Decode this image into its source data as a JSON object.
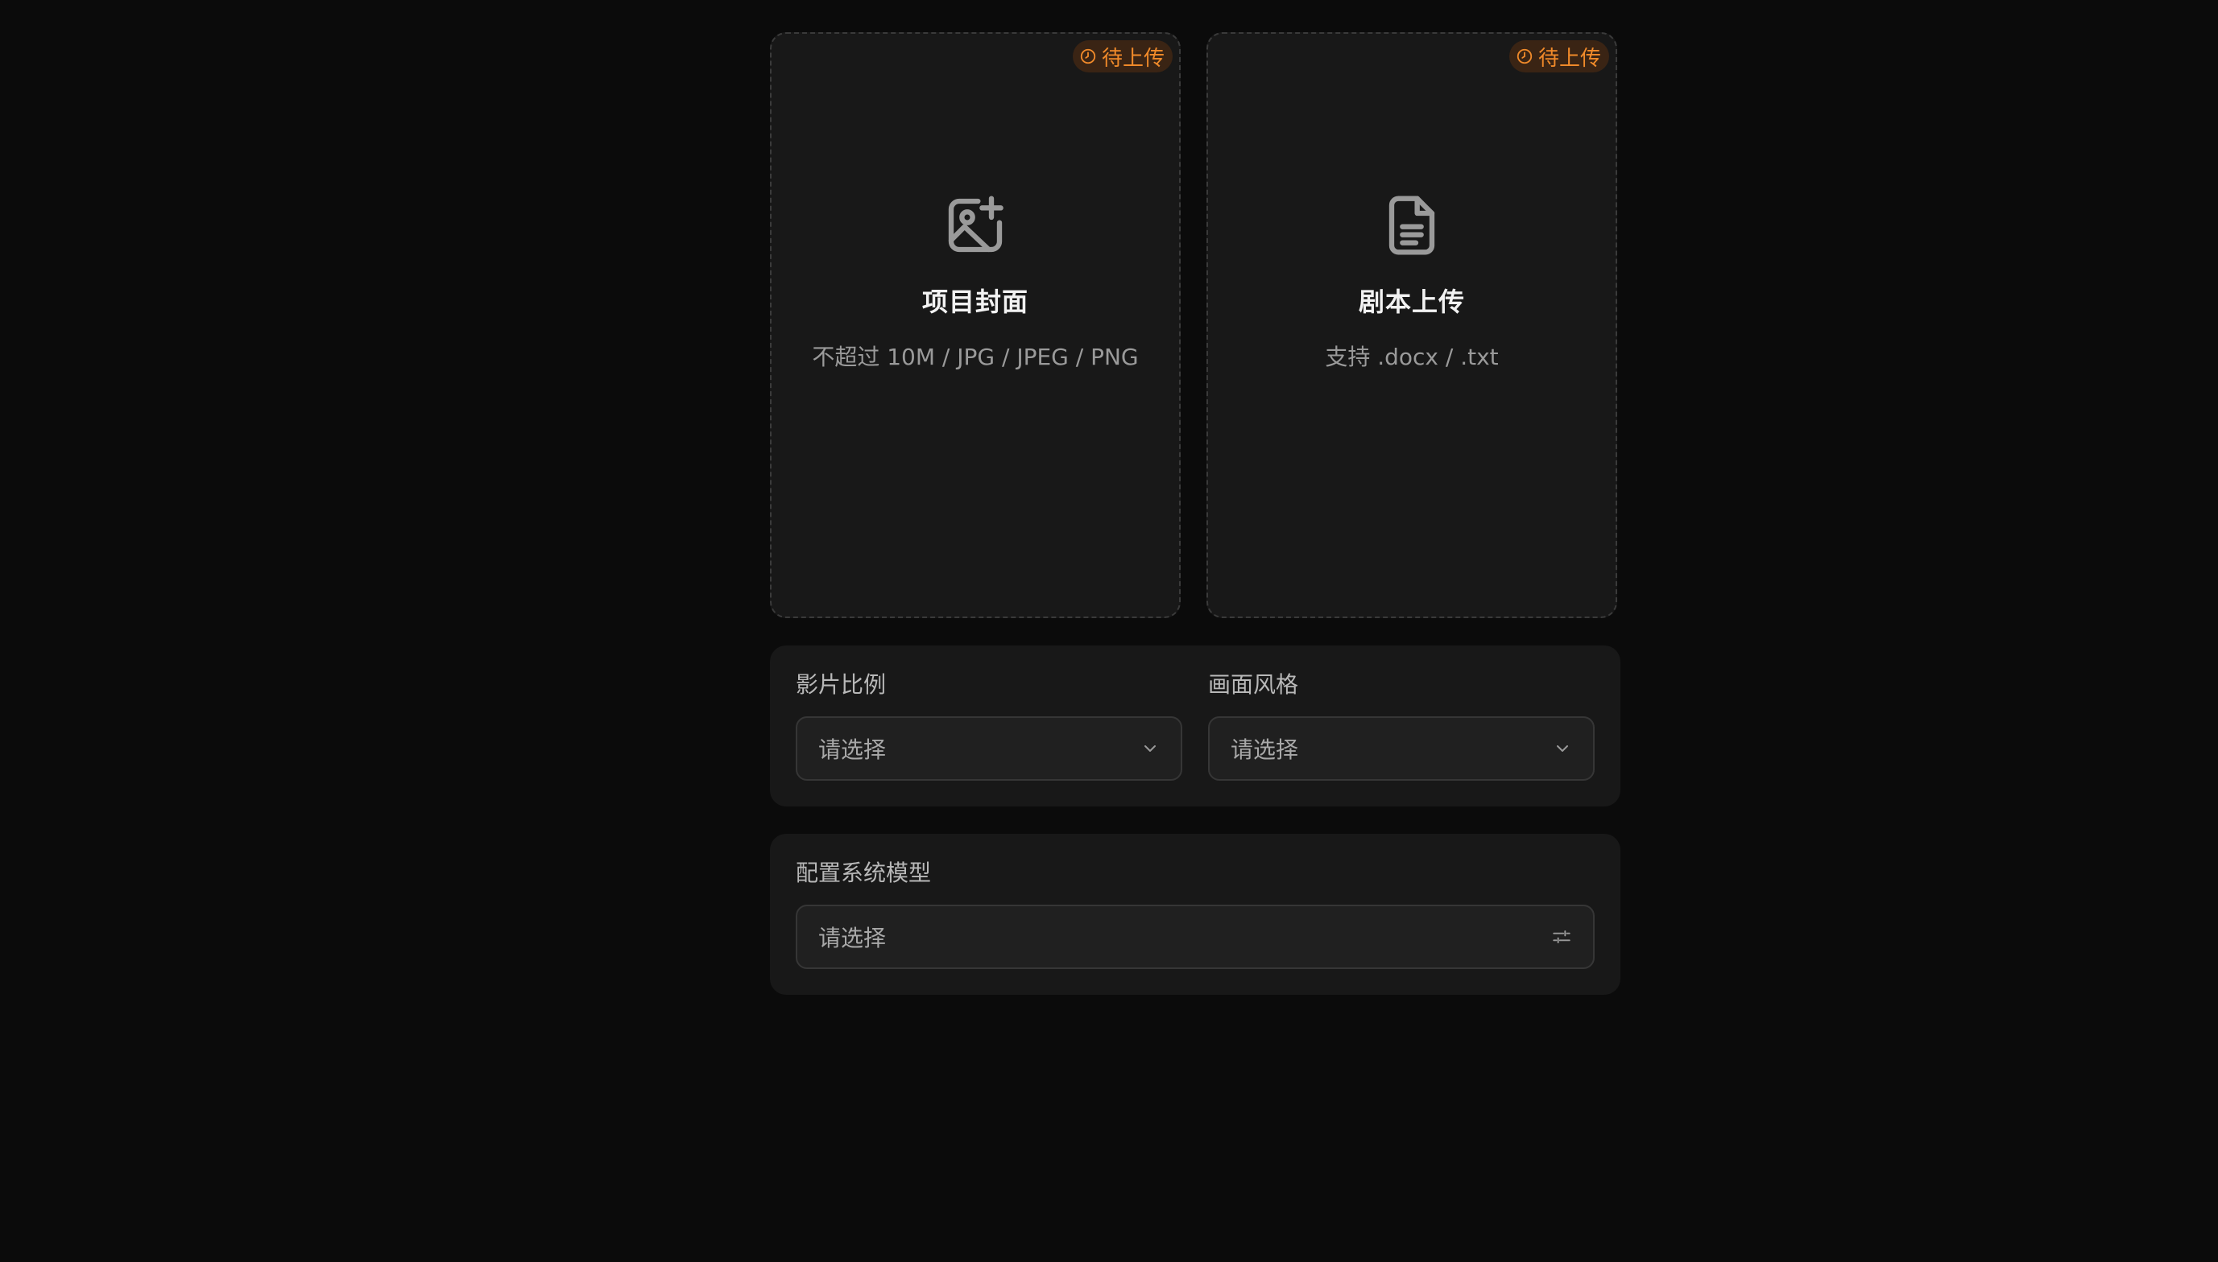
{
  "uploads": [
    {
      "badge": "待上传",
      "icon": "image-plus-icon",
      "title": "项目封面",
      "hint": "不超过 10M / JPG / JPEG / PNG"
    },
    {
      "badge": "待上传",
      "icon": "document-icon",
      "title": "剧本上传",
      "hint": "支持 .docx / .txt"
    }
  ],
  "settings": {
    "aspect_ratio": {
      "label": "影片比例",
      "placeholder": "请选择",
      "icon": "chevron-down-icon"
    },
    "visual_style": {
      "label": "画面风格",
      "placeholder": "请选择",
      "icon": "chevron-down-icon"
    }
  },
  "model": {
    "label": "配置系统模型",
    "placeholder": "请选择",
    "icon": "sliders-icon"
  },
  "colors": {
    "background": "#0b0b0b",
    "card": "#181818",
    "badge_text": "#f08a2a",
    "badge_bg": "#3a2414"
  }
}
